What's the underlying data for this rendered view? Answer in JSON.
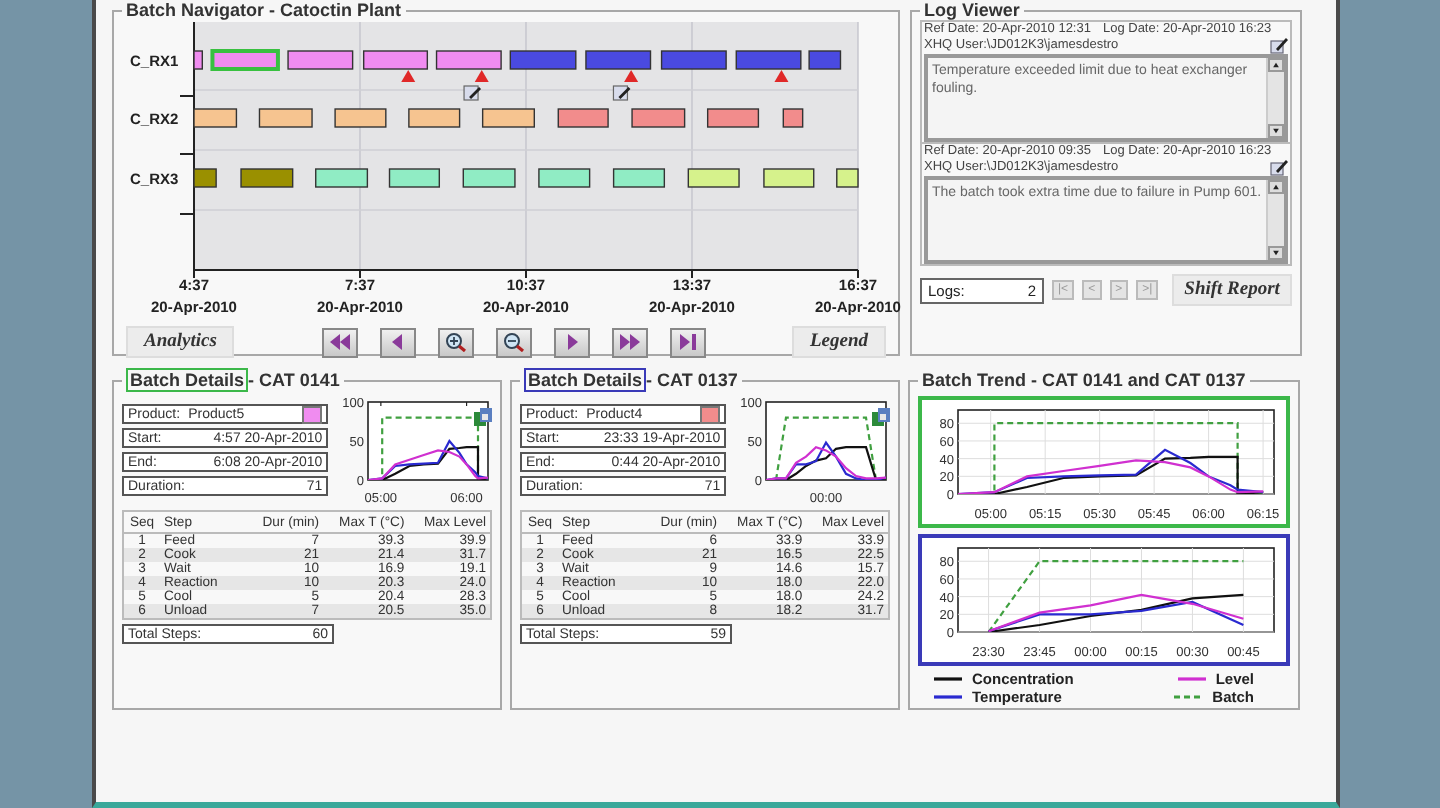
{
  "navigator": {
    "title": "Batch Navigator - Catoctin Plant",
    "rows": [
      {
        "label": "C_RX1",
        "batches": [
          {
            "color": "#f08cf0",
            "selected": false,
            "alarm": false,
            "note": false
          },
          {
            "color": "#f08cf0",
            "selected": true,
            "alarm": false,
            "note": false
          },
          {
            "color": "#f08cf0",
            "selected": false,
            "alarm": false,
            "note": false
          },
          {
            "color": "#f08cf0",
            "selected": false,
            "alarm": true,
            "note": false
          },
          {
            "color": "#f08cf0",
            "selected": false,
            "alarm": true,
            "note": true
          },
          {
            "color": "#4a4ae0",
            "selected": false,
            "alarm": false,
            "note": false
          },
          {
            "color": "#4a4ae0",
            "selected": false,
            "alarm": true,
            "note": true
          },
          {
            "color": "#4a4ae0",
            "selected": false,
            "alarm": false,
            "note": false
          },
          {
            "color": "#4a4ae0",
            "selected": false,
            "alarm": true,
            "note": false
          },
          {
            "color": "#4a4ae0",
            "selected": false,
            "alarm": false,
            "note": false
          }
        ]
      },
      {
        "label": "C_RX2",
        "batches": [
          {
            "color": "#f6c490",
            "selected": false,
            "alarm": false,
            "note": false
          },
          {
            "color": "#f6c490",
            "selected": false,
            "alarm": false,
            "note": false
          },
          {
            "color": "#f6c490",
            "selected": false,
            "alarm": false,
            "note": false
          },
          {
            "color": "#f6c490",
            "selected": false,
            "alarm": false,
            "note": false
          },
          {
            "color": "#f6c490",
            "selected": false,
            "alarm": false,
            "note": false
          },
          {
            "color": "#f28c8c",
            "selected": false,
            "alarm": false,
            "note": false
          },
          {
            "color": "#f28c8c",
            "selected": false,
            "alarm": false,
            "note": false
          },
          {
            "color": "#f28c8c",
            "selected": false,
            "alarm": false,
            "note": false
          },
          {
            "color": "#f28c8c",
            "selected": false,
            "alarm": false,
            "note": false
          }
        ]
      },
      {
        "label": "C_RX3",
        "batches": [
          {
            "color": "#9a9000",
            "selected": false,
            "alarm": false,
            "note": false
          },
          {
            "color": "#9a9000",
            "selected": false,
            "alarm": false,
            "note": false
          },
          {
            "color": "#90ecc4",
            "selected": false,
            "alarm": false,
            "note": false
          },
          {
            "color": "#90ecc4",
            "selected": false,
            "alarm": false,
            "note": false
          },
          {
            "color": "#90ecc4",
            "selected": false,
            "alarm": false,
            "note": false
          },
          {
            "color": "#90ecc4",
            "selected": false,
            "alarm": false,
            "note": false
          },
          {
            "color": "#90ecc4",
            "selected": false,
            "alarm": false,
            "note": false
          },
          {
            "color": "#d6f28c",
            "selected": false,
            "alarm": false,
            "note": false
          },
          {
            "color": "#d6f28c",
            "selected": false,
            "alarm": false,
            "note": false
          },
          {
            "color": "#d6f28c",
            "selected": false,
            "alarm": false,
            "note": false
          }
        ]
      }
    ],
    "ticks": [
      {
        "time": "4:37",
        "date": "20-Apr-2010"
      },
      {
        "time": "7:37",
        "date": "20-Apr-2010"
      },
      {
        "time": "10:37",
        "date": "20-Apr-2010"
      },
      {
        "time": "13:37",
        "date": "20-Apr-2010"
      },
      {
        "time": "16:37",
        "date": "20-Apr-2010"
      }
    ],
    "analytics": "Analytics",
    "legend": "Legend"
  },
  "log_viewer": {
    "title": "Log Viewer",
    "entries": [
      {
        "ref": "Ref Date: 20-Apr-2010 12:31",
        "logged": "Log Date: 20-Apr-2010 16:23",
        "user": "XHQ User:\\JD012K3\\jamesdestro",
        "text": "Temperature exceeded limit due to heat exchanger fouling."
      },
      {
        "ref": "Ref Date: 20-Apr-2010 09:35",
        "logged": "Log Date: 20-Apr-2010 16:23",
        "user": "XHQ User:\\JD012K3\\jamesdestro",
        "text": "The batch took extra time due to failure in Pump 601."
      }
    ],
    "count_label": "Logs:",
    "count": "2",
    "nav": [
      "|<",
      "<",
      ">",
      ">|"
    ],
    "shift_report": "Shift Report"
  },
  "details": [
    {
      "title": "Batch Details",
      "batch": "- CAT 0141",
      "color": "#3cb84a",
      "product": {
        "label": "Product:",
        "value": "Product5",
        "color": "#f08cf0"
      },
      "fields": [
        {
          "label": "Start:",
          "value": "4:57 20-Apr-2010"
        },
        {
          "label": "End:",
          "value": "6:08 20-Apr-2010"
        },
        {
          "label": "Duration:",
          "value": "71"
        }
      ],
      "chart_data": {
        "type": "line",
        "x": [
          291,
          301,
          301,
          310,
          320,
          330,
          340,
          348,
          355,
          360,
          366,
          368,
          368,
          375
        ],
        "xlim": [
          291,
          375
        ],
        "ylim": [
          0,
          100
        ],
        "yticks": [
          0,
          50,
          100
        ],
        "xticks": [
          {
            "value": 300,
            "label": "05:00"
          },
          {
            "value": 360,
            "label": "06:00"
          }
        ],
        "series": [
          {
            "color": "#40a040",
            "line_style": "dashed",
            "values": [
              0,
              0,
              80,
              80,
              80,
              80,
              80,
              80,
              80,
              80,
              80,
              80,
              0,
              0
            ]
          },
          {
            "color": "#111111",
            "line_style": "solid",
            "values": [
              0,
              0,
              0,
              8,
              18,
              20,
              21,
              40,
              41,
              42,
              42,
              42,
              0,
              2
            ]
          },
          {
            "color": "#2a2ad0",
            "line_style": "solid",
            "values": [
              0,
              2,
              2,
              18,
              20,
              21,
              22,
              50,
              35,
              20,
              10,
              5,
              5,
              2
            ]
          },
          {
            "color": "#d030d0",
            "line_style": "solid",
            "values": [
              0,
              2,
              2,
              20,
              26,
              32,
              38,
              36,
              30,
              20,
              5,
              2,
              2,
              3
            ]
          }
        ]
      },
      "columns": [
        "Seq",
        "Step",
        "Dur (min)",
        "Max T (°C)",
        "Max Level"
      ],
      "rows": [
        [
          "1",
          "Feed",
          "7",
          "39.3",
          "39.9"
        ],
        [
          "2",
          "Cook",
          "21",
          "21.4",
          "31.7"
        ],
        [
          "3",
          "Wait",
          "10",
          "16.9",
          "19.1"
        ],
        [
          "4",
          "Reaction",
          "10",
          "20.3",
          "24.0"
        ],
        [
          "5",
          "Cool",
          "5",
          "20.4",
          "28.3"
        ],
        [
          "6",
          "Unload",
          "7",
          "20.5",
          "35.0"
        ]
      ],
      "total": {
        "label": "Total Steps:",
        "value": "60"
      }
    },
    {
      "title": "Batch Details",
      "batch": "- CAT 0137",
      "color": "#3a3ab8",
      "product": {
        "label": "Product:",
        "value": "Product4",
        "color": "#f28c8c"
      },
      "fields": [
        {
          "label": "Start:",
          "value": "23:33 19-Apr-2010"
        },
        {
          "label": "End:",
          "value": "0:44 20-Apr-2010"
        },
        {
          "label": "Duration:",
          "value": "71"
        }
      ],
      "chart_data": {
        "type": "line",
        "ylim": [
          0,
          100
        ],
        "yticks": [
          0,
          50,
          100
        ],
        "annotations": [
          "00:00"
        ],
        "series": [
          {
            "color": "#40a040",
            "line_style": "dashed",
            "values": [
              0,
              0,
              80,
              80,
              80,
              80,
              80,
              80,
              80,
              80,
              80,
              0,
              0
            ]
          },
          {
            "color": "#111111",
            "line_style": "solid",
            "values": [
              0,
              0,
              0,
              8,
              18,
              25,
              28,
              40,
              42,
              42,
              42,
              0,
              2
            ]
          },
          {
            "color": "#2a2ad0",
            "line_style": "solid",
            "values": [
              0,
              2,
              2,
              20,
              20,
              24,
              48,
              30,
              8,
              2,
              0,
              0,
              3
            ]
          },
          {
            "color": "#d030d0",
            "line_style": "solid",
            "values": [
              0,
              2,
              2,
              22,
              30,
              42,
              38,
              30,
              15,
              5,
              2,
              2,
              3
            ]
          }
        ]
      },
      "columns": [
        "Seq",
        "Step",
        "Dur (min)",
        "Max T (°C)",
        "Max Level"
      ],
      "rows": [
        [
          "1",
          "Feed",
          "6",
          "33.9",
          "33.9"
        ],
        [
          "2",
          "Cook",
          "21",
          "16.5",
          "22.5"
        ],
        [
          "3",
          "Wait",
          "9",
          "14.6",
          "15.7"
        ],
        [
          "4",
          "Reaction",
          "10",
          "18.0",
          "22.0"
        ],
        [
          "5",
          "Cool",
          "5",
          "18.0",
          "24.2"
        ],
        [
          "6",
          "Unload",
          "8",
          "18.2",
          "31.7"
        ]
      ],
      "total": {
        "label": "Total Steps:",
        "value": "59"
      }
    }
  ],
  "trend": {
    "title": "Batch Trend - CAT 0141 and CAT 0137",
    "charts": [
      {
        "color": "#3cb84a",
        "chart_data": {
          "type": "line",
          "grid": true,
          "x": [
            291,
            301,
            301,
            310,
            320,
            330,
            340,
            348,
            355,
            360,
            366,
            368,
            368,
            375
          ],
          "xlim": [
            291,
            378
          ],
          "ylim": [
            0,
            95
          ],
          "yticks": [
            0,
            20,
            40,
            60,
            80
          ],
          "xticks": [
            {
              "value": 300,
              "label": "05:00"
            },
            {
              "value": 315,
              "label": "05:15"
            },
            {
              "value": 330,
              "label": "05:30"
            },
            {
              "value": 345,
              "label": "05:45"
            },
            {
              "value": 360,
              "label": "06:00"
            },
            {
              "value": 375,
              "label": "06:15"
            }
          ],
          "series": [
            {
              "color": "#40a040",
              "line_style": "dashed",
              "values": [
                0,
                0,
                80,
                80,
                80,
                80,
                80,
                80,
                80,
                80,
                80,
                80,
                0,
                0
              ]
            },
            {
              "color": "#111111",
              "line_style": "solid",
              "values": [
                0,
                0,
                0,
                8,
                18,
                20,
                21,
                40,
                41,
                42,
                42,
                42,
                0,
                2
              ]
            },
            {
              "color": "#2a2ad0",
              "line_style": "solid",
              "values": [
                0,
                2,
                2,
                18,
                20,
                21,
                22,
                50,
                35,
                20,
                10,
                5,
                5,
                2
              ]
            },
            {
              "color": "#d030d0",
              "line_style": "solid",
              "values": [
                0,
                2,
                2,
                20,
                26,
                32,
                38,
                36,
                30,
                20,
                5,
                2,
                2,
                3
              ]
            }
          ]
        }
      },
      {
        "color": "#3a3ab8",
        "chart_data": {
          "type": "line",
          "grid": true,
          "categories": [
            "23:30",
            "23:45",
            "00:00",
            "00:15",
            "00:30",
            "00:45"
          ],
          "ylim": [
            0,
            95
          ],
          "yticks": [
            0,
            20,
            40,
            60,
            80
          ],
          "series": [
            {
              "color": "#40a040",
              "line_style": "dashed",
              "values": [
                0,
                80,
                80,
                80,
                80,
                80
              ]
            },
            {
              "color": "#111111",
              "line_style": "solid",
              "values": [
                0,
                8,
                18,
                25,
                38,
                42
              ]
            },
            {
              "color": "#2a2ad0",
              "line_style": "solid",
              "values": [
                1,
                20,
                20,
                24,
                34,
                8
              ]
            },
            {
              "color": "#d030d0",
              "line_style": "solid",
              "values": [
                1,
                22,
                30,
                42,
                32,
                15
              ]
            }
          ]
        }
      }
    ],
    "legend": [
      {
        "label": "Concentration",
        "color": "#111111",
        "kind": "solid"
      },
      {
        "label": "Level",
        "color": "#d030d0",
        "kind": "solid"
      },
      {
        "label": "Temperature",
        "color": "#2a2ad0",
        "kind": "solid"
      },
      {
        "label": "Batch",
        "color": "#40a040",
        "kind": "dashed"
      }
    ]
  }
}
